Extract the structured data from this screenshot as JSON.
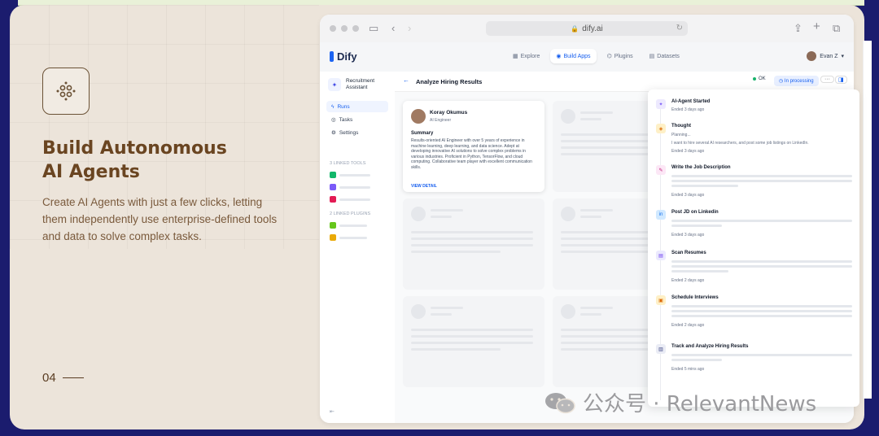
{
  "feature": {
    "title_line1": "Build Autonomous",
    "title_line2": "AI Agents",
    "description": "Create AI Agents with just a few clicks, letting them independently use enterprise-defined tools and data to solve complex tasks.",
    "page_number": "04"
  },
  "browser": {
    "url": "dify.ai"
  },
  "app": {
    "logo": "Dify",
    "nav": {
      "explore": "Explore",
      "build_apps": "Build Apps",
      "plugins": "Plugins",
      "datasets": "Datasets"
    },
    "user": "Evan Z"
  },
  "sidebar": {
    "app_name": "Recruitment Assistant",
    "items": [
      {
        "label": "Runs"
      },
      {
        "label": "Tasks"
      },
      {
        "label": "Settings"
      }
    ],
    "linked_tools_title": "3 LINKED TOOLS",
    "linked_plugins_title": "2 LINKED PLUGINS"
  },
  "main": {
    "title": "Analyze Hiring Results",
    "ok_label": "OK",
    "status_label": "In processing"
  },
  "candidate": {
    "name": "Koray Okumus",
    "role": "AI Engineer",
    "summary_title": "Summary",
    "summary": "Results-oriented AI Engineer with over 5 years of experience in machine learning, deep learning, and data science. Adept at developing innovative AI solutions to solve complex problems in various industries. Proficient in Python, TensorFlow, and cloud computing. Collaborative team player with excellent communication skills.",
    "view_detail": "VIEW DETAIL"
  },
  "steps": [
    {
      "title": "AI-Agent Started",
      "time": "Ended 3 days ago"
    },
    {
      "title": "Thought",
      "sub1": "Planning...",
      "sub2": "I want to hire several AI researchers, and post some job listings on LinkedIn.",
      "time": "Ended 3 days ago"
    },
    {
      "title": "Write the Job Description",
      "time": "Ended 3 days ago"
    },
    {
      "title": "Post JD on Linkedin",
      "time": "Ended 3 days ago"
    },
    {
      "title": "Scan Resumes",
      "time": "Ended 2 days ago"
    },
    {
      "title": "Schedule Interviews",
      "time": "Ended 2 days ago"
    },
    {
      "title": "Track and Analyze Hiring Results",
      "time": "Ended 5 mins ago"
    }
  ],
  "watermark": {
    "text": "公众号 · RelevantNews"
  }
}
